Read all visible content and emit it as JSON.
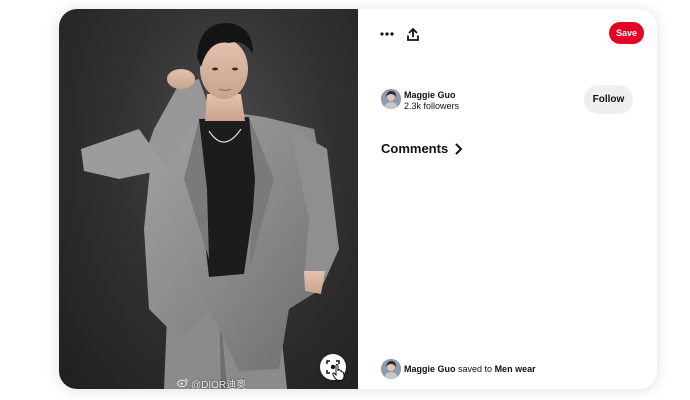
{
  "pin": {
    "watermark_text": "@DIOR迪奥",
    "watermark_icon": "weibo-icon",
    "visual_search_icon": "visual-search-icon"
  },
  "actions": {
    "more_icon": "more-dots-icon",
    "share_icon": "share-upload-icon",
    "save_label": "Save"
  },
  "creator": {
    "name": "Maggie Guo",
    "followers": "2.3k followers",
    "follow_label": "Follow"
  },
  "comments": {
    "title": "Comments",
    "expand_icon": "chevron-right-icon"
  },
  "saved_by": {
    "user": "Maggie Guo",
    "verb": "saved to",
    "board": "Men wear"
  },
  "colors": {
    "save_button": "#e60023",
    "follow_button": "#efefef",
    "photo_background": "#323232",
    "suit_gray": "#8e8e8e"
  }
}
